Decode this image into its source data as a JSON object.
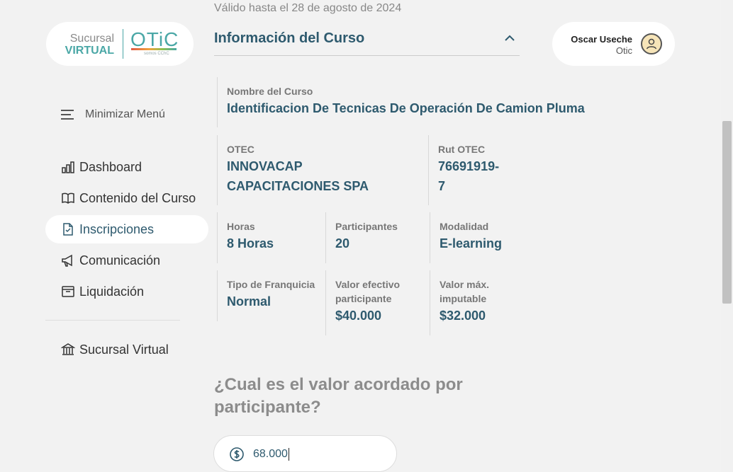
{
  "logo": {
    "line1": "Sucursal",
    "line2": "VIRTUAL",
    "brand": "OTiC",
    "sub": "somos CChC"
  },
  "sidebar": {
    "minimize_label": "Minimizar Menú",
    "items": [
      {
        "label": "Dashboard",
        "icon": "chart-bars-icon"
      },
      {
        "label": "Contenido del Curso",
        "icon": "book-icon"
      },
      {
        "label": "Inscripciones",
        "icon": "document-check-icon"
      },
      {
        "label": "Comunicación",
        "icon": "megaphone-icon"
      },
      {
        "label": "Liquidación",
        "icon": "archive-box-icon"
      },
      {
        "label": "Sucursal Virtual",
        "icon": "bank-building-icon"
      }
    ]
  },
  "header": {
    "valid_text": "Válido hasta el 28 de agosto de 2024",
    "section_title": "Información del Curso"
  },
  "user": {
    "name": "Oscar Useche",
    "org": "Otic"
  },
  "course": {
    "name_label": "Nombre del Curso",
    "name_value": "Identificacion De Tecnicas De Operación De Camion Pluma",
    "otec_label": "OTEC",
    "otec_value": "INNOVACAP CAPACITACIONES SPA",
    "rut_label": "Rut OTEC",
    "rut_value": "76691919-7",
    "horas_label": "Horas",
    "horas_value": "8 Horas",
    "participantes_label": "Participantes",
    "participantes_value": "20",
    "modalidad_label": "Modalidad",
    "modalidad_value": "E-learning",
    "franquicia_label": "Tipo de Franquicia",
    "franquicia_value": "Normal",
    "valor_efectivo_label": "Valor efectivo participante",
    "valor_efectivo_value": "$40.000",
    "valor_max_label": "Valor máx. imputable",
    "valor_max_value": "$32.000"
  },
  "question": {
    "text": "¿Cual es el valor acordado por participante?",
    "input_value": "68.000"
  },
  "colors": {
    "accent": "#2e5a6e",
    "brand": "#4aa7a6",
    "background": "#f2f2f2"
  }
}
